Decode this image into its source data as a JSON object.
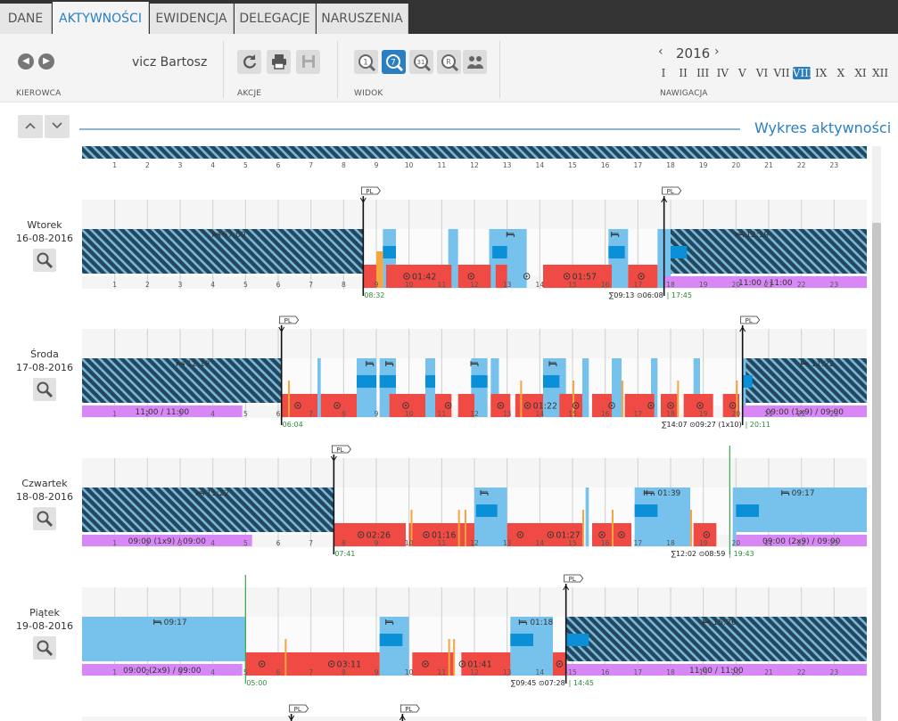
{
  "tabs": [
    "DANE",
    "AKTYWNOŚCI",
    "EWIDENCJA",
    "DELEGACJE",
    "NARUSZENIA"
  ],
  "active_tab": 1,
  "toolbar": {
    "driver_name": "vicz Bartosz",
    "group_kierowca": "KIEROWCA",
    "group_akcje": "AKCJE",
    "group_widok": "WIDOK",
    "group_nawigacja": "NAWIGACJA",
    "year": "2016",
    "prev_year": "‹",
    "next_year": "›",
    "months": [
      "I",
      "II",
      "III",
      "IV",
      "V",
      "VI",
      "VII",
      "VIII",
      "IX",
      "X",
      "XI",
      "XII"
    ],
    "selected_month": 7
  },
  "section_title": "Wykres aktywności",
  "hours": [
    "1",
    "2",
    "3",
    "4",
    "5",
    "6",
    "7",
    "8",
    "9",
    "10",
    "11",
    "12",
    "13",
    "14",
    "15",
    "16",
    "17",
    "18",
    "19",
    "20",
    "21",
    "22",
    "23"
  ],
  "icons": [
    "chevron-left-icon",
    "chevron-right-icon",
    "refresh-icon",
    "print-icon",
    "save-icon",
    "day-view-icon",
    "week-view-icon",
    "month-view-icon",
    "range-view-icon",
    "crew-icon",
    "chevron-up-icon",
    "chevron-down-icon",
    "search-icon",
    "flag-icon",
    "bed-icon",
    "wheel-icon",
    "sum-icon"
  ],
  "colors": {
    "drive": "#ef4b44",
    "rest": "#76c2ec",
    "work": "#f7a53c",
    "avail": "#0b8fd6",
    "week_rest": "#23485e",
    "period": "#d888f6",
    "accent": "#2a7fc3"
  },
  "days": [
    {
      "weekday": "Wtorek",
      "date": "16-08-2016",
      "rest_left": {
        "end": 8.6,
        "label": "67:00",
        "label_h": 4.3
      },
      "rest_right": {
        "start": 17.8,
        "label": "12:19",
        "label_h": 20.3
      },
      "period_bar": {
        "start": 17.8,
        "end": 24,
        "label": "11:00 / 11:00"
      },
      "drive": [
        [
          8.6,
          9.0
        ],
        [
          9.3,
          11.3
        ],
        [
          11.5,
          12.5
        ],
        [
          12.65,
          13
        ],
        [
          14.1,
          16.2
        ],
        [
          16.7,
          17.6
        ]
      ],
      "drive_labels": [
        {
          "at": 10.2,
          "text": "01:42"
        },
        {
          "at": 11.9,
          "text": ""
        },
        {
          "at": 13.6,
          "text": ""
        },
        {
          "at": 15.1,
          "text": "01:57"
        },
        {
          "at": 17.1,
          "text": ""
        }
      ],
      "rest_blocks": [
        [
          9.2,
          9.6
        ],
        [
          11.2,
          11.5
        ],
        [
          12.45,
          13.6
        ],
        [
          16.1,
          16.7
        ],
        [
          17.6,
          18.0
        ]
      ],
      "avail_blocks": [
        [
          9.2,
          9.6
        ],
        [
          12.55,
          13.0
        ],
        [
          16.1,
          16.6
        ],
        [
          18.0,
          18.5
        ]
      ],
      "work_marks": [
        [
          9.0,
          9.2
        ]
      ],
      "bed_marks": [
        13.1,
        16.3
      ],
      "start_flag": {
        "at": 8.6,
        "label": "PL"
      },
      "end_flag": {
        "at": 17.8,
        "label": "PL"
      },
      "start_time": "08:32",
      "sum_text": "∑09:13 ⊙06:08",
      "end_time": "17:45"
    },
    {
      "weekday": "Środa",
      "date": "17-08-2016",
      "rest_left": {
        "end": 6.1,
        "label": "12:19",
        "label_h": 3.2
      },
      "rest_right": {
        "start": 20.2,
        "label": "11:22",
        "label_h": 22.3
      },
      "period_bar": {
        "start": 0,
        "end": 4.9,
        "label": "11:00 / 11:00"
      },
      "period_bar2": {
        "start": 20.2,
        "end": 24,
        "label": "09:00 (1x9) / 09:00"
      },
      "drive": [
        [
          6.1,
          7.2
        ],
        [
          7.3,
          8.4
        ],
        [
          9.4,
          10.5
        ],
        [
          10.8,
          11.3
        ],
        [
          11.5,
          12.0
        ],
        [
          12.5,
          13.1
        ],
        [
          13.25,
          14.1
        ],
        [
          14.6,
          15.3
        ],
        [
          15.6,
          16.2
        ],
        [
          16.6,
          17.5
        ],
        [
          17.7,
          18.2
        ],
        [
          18.4,
          19.3
        ],
        [
          19.6,
          20.1
        ]
      ],
      "drive_labels": [
        {
          "at": 6.6,
          "text": ""
        },
        {
          "at": 7.8,
          "text": ""
        },
        {
          "at": 9.9,
          "text": ""
        },
        {
          "at": 11.2,
          "text": ""
        },
        {
          "at": 12.8,
          "text": ""
        },
        {
          "at": 13.9,
          "text": "01:22"
        },
        {
          "at": 15.1,
          "text": ""
        },
        {
          "at": 16.2,
          "text": ""
        },
        {
          "at": 17.4,
          "text": ""
        },
        {
          "at": 18.0,
          "text": ""
        },
        {
          "at": 18.9,
          "text": ""
        },
        {
          "at": 19.9,
          "text": ""
        }
      ],
      "rest_blocks": [
        [
          7.2,
          7.3
        ],
        [
          8.4,
          9.0
        ],
        [
          9.1,
          9.6
        ],
        [
          10.5,
          10.8
        ],
        [
          11.9,
          12.4
        ],
        [
          12.5,
          12.75
        ],
        [
          14.1,
          14.8
        ],
        [
          15.3,
          15.5
        ],
        [
          16.2,
          16.5
        ],
        [
          17.4,
          17.6
        ],
        [
          18.7,
          18.9
        ],
        [
          20.2,
          20.3
        ]
      ],
      "avail_blocks": [
        [
          8.4,
          9.0
        ],
        [
          9.1,
          9.6
        ],
        [
          10.5,
          10.8
        ],
        [
          11.9,
          12.4
        ],
        [
          14.1,
          14.6
        ],
        [
          20.2,
          20.5
        ]
      ],
      "work_marks": [
        [
          6.3,
          6.35
        ],
        [
          13.4,
          13.45
        ],
        [
          15.0,
          15.05
        ],
        [
          16.5,
          16.55
        ],
        [
          18.2,
          18.25
        ],
        [
          20.0,
          20.05
        ]
      ],
      "bed_marks": [
        8.8,
        9.4,
        12.0,
        14.4
      ],
      "start_flag": {
        "at": 6.1,
        "label": "PL"
      },
      "end_flag": {
        "at": 20.2,
        "label": "PL"
      },
      "start_time": "06:04",
      "sum_text": "∑14:07 ⊙09:27 (1x10)",
      "end_time": "20:11"
    },
    {
      "weekday": "Czwartek",
      "date": "18-08-2016",
      "rest_left": {
        "end": 7.7,
        "label": "11:22",
        "label_h": 3.8
      },
      "rest_right": {
        "start": 20.0,
        "label": "09:17",
        "label_h": 21.7,
        "light": true
      },
      "period_bar": {
        "start": 0,
        "end": 5.2,
        "label": "09:00 (1x9) / 09:00"
      },
      "period_bar2": {
        "start": 20.0,
        "end": 24,
        "label": "09:00 (2x9) / 09:00"
      },
      "drive": [
        [
          7.7,
          9.9
        ],
        [
          10.0,
          12.0
        ],
        [
          13.0,
          15.3
        ],
        [
          15.6,
          16.8
        ],
        [
          18.7,
          19.4
        ]
      ],
      "drive_labels": [
        {
          "at": 8.8,
          "text": "02:26"
        },
        {
          "at": 10.8,
          "text": "01:16"
        },
        {
          "at": 13.4,
          "text": ""
        },
        {
          "at": 14.6,
          "text": "01:27"
        },
        {
          "at": 15.9,
          "text": ""
        },
        {
          "at": 16.5,
          "text": ""
        },
        {
          "at": 19.1,
          "text": ""
        }
      ],
      "rest_blocks": [
        [
          12.0,
          13.0
        ],
        [
          15.4,
          15.5
        ],
        [
          16.9,
          18.6
        ],
        [
          19.9,
          20.0
        ]
      ],
      "avail_blocks": [
        [
          12.05,
          12.7
        ],
        [
          16.9,
          17.6
        ],
        [
          20.0,
          20.7
        ]
      ],
      "work_marks": [
        [
          10.05,
          10.1
        ],
        [
          11.5,
          11.55
        ],
        [
          11.7,
          11.75
        ],
        [
          15.3,
          15.35
        ],
        [
          16.2,
          16.25
        ],
        [
          18.6,
          18.65
        ]
      ],
      "bed_marks": [
        12.3,
        17.3
      ],
      "bed_labels": [
        {
          "at": 17.6,
          "text": "01:39"
        }
      ],
      "start_flag": {
        "at": 7.7,
        "label": "PL"
      },
      "start_time": "07:41",
      "sum_text": "∑12:02 ⊙08:59",
      "end_time": "19:43"
    },
    {
      "weekday": "Piątek",
      "date": "19-08-2016",
      "rest_left": {
        "end": 5.0,
        "label": "09:17",
        "label_h": 2.5,
        "light": true
      },
      "rest_right": {
        "start": 14.8,
        "label": "15:26",
        "label_h": 19.3
      },
      "period_bar": {
        "start": 0,
        "end": 4.9,
        "label": "09:00 (2x9) / 09:00"
      },
      "period_bar2": {
        "start": 14.8,
        "end": 24,
        "label": "11:00 / 11:00"
      },
      "drive": [
        [
          5.0,
          6.0
        ],
        [
          6.0,
          9.1
        ],
        [
          10.1,
          11.4
        ],
        [
          11.6,
          13.1
        ],
        [
          14.4,
          14.8
        ]
      ],
      "drive_labels": [
        {
          "at": 5.5,
          "text": ""
        },
        {
          "at": 7.9,
          "text": "03:11"
        },
        {
          "at": 10.5,
          "text": ""
        },
        {
          "at": 11.9,
          "text": "01:41"
        },
        {
          "at": 14.6,
          "text": ""
        }
      ],
      "rest_blocks": [
        [
          9.1,
          10.0
        ],
        [
          13.1,
          14.4
        ]
      ],
      "avail_blocks": [
        [
          9.1,
          9.8
        ],
        [
          13.1,
          13.8
        ],
        [
          14.8,
          15.5
        ]
      ],
      "work_marks": [
        [
          6.2,
          6.25
        ],
        [
          11.2,
          11.25
        ],
        [
          11.35,
          11.4
        ]
      ],
      "bed_marks": [
        9.4
      ],
      "bed_labels": [
        {
          "at": 13.7,
          "text": "01:18"
        }
      ],
      "end_flag": {
        "at": 14.8,
        "label": "PL"
      },
      "start_time": "05:00",
      "sum_text": "∑09:45 ⊙07:28",
      "end_time": "14:45"
    }
  ]
}
